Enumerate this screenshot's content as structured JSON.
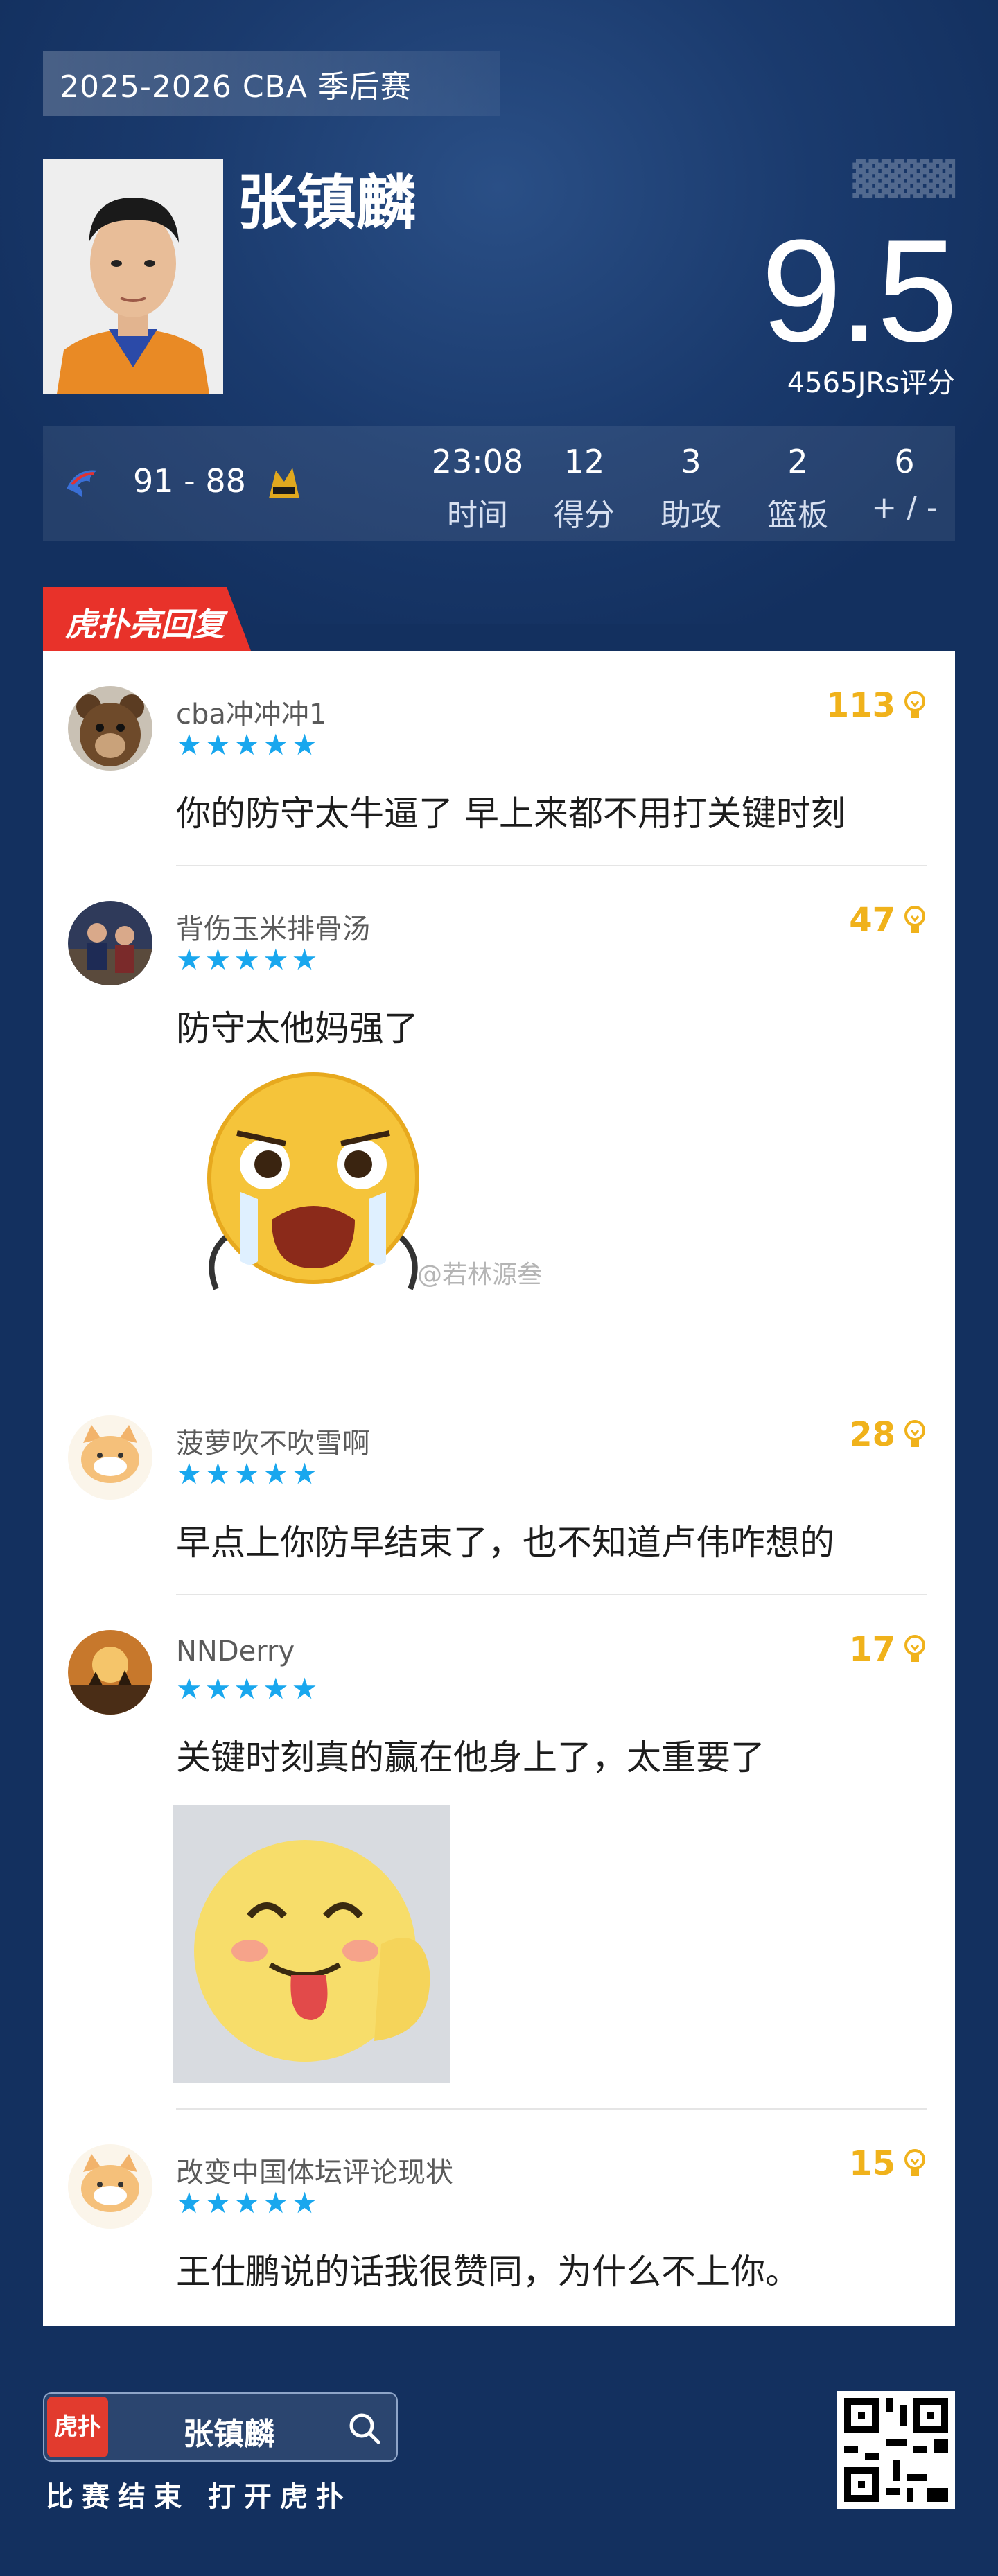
{
  "header": {
    "event": "2025-2026 CBA 季后赛",
    "player_name": "张镇麟",
    "rating": "9.5",
    "rating_sub": "4565JRs评分"
  },
  "match": {
    "score": "91 - 88",
    "stats": [
      {
        "value": "23:08",
        "label": "时间"
      },
      {
        "value": "12",
        "label": "得分"
      },
      {
        "value": "3",
        "label": "助攻"
      },
      {
        "value": "2",
        "label": "篮板"
      },
      {
        "value": "6",
        "label": "+ / -"
      }
    ]
  },
  "section_tag": "虎扑亮回复",
  "stars": "★★★★★",
  "comments": [
    {
      "user": "cba冲冲冲1",
      "likes": "113",
      "text": "你的防守太牛逼了 早上来都不用打关键时刻",
      "avatar": "bear-avatar"
    },
    {
      "user": "背伤玉米排骨汤",
      "likes": "47",
      "text": "防守太他妈强了",
      "avatar": "photo-avatar"
    },
    {
      "user": "菠萝吹不吹雪啊",
      "likes": "28",
      "text": "早点上你防早结束了，也不知道卢伟咋想的",
      "avatar": "cat-avatar"
    },
    {
      "user": "NNDerry",
      "likes": "17",
      "text": "关键时刻真的赢在他身上了，太重要了",
      "avatar": "sunset-avatar"
    },
    {
      "user": "改变中国体坛评论现状",
      "likes": "15",
      "text": "王仕鹏说的话我很赞同，为什么不上你。",
      "avatar": "cat-avatar"
    }
  ],
  "watermark": "@若林源叁",
  "footer": {
    "app_logo": "虎扑",
    "name": "张镇麟",
    "note": "比赛结束 打开虎扑"
  }
}
